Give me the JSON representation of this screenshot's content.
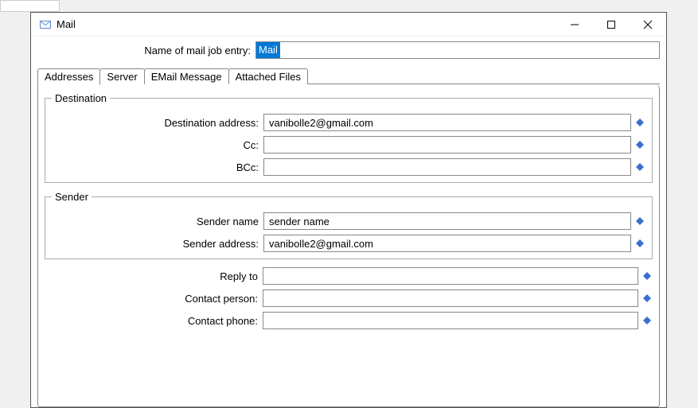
{
  "window": {
    "title": "Mail"
  },
  "topfield": {
    "label": "Name of mail job entry:",
    "value": "Mail"
  },
  "tabs": {
    "addresses": "Addresses",
    "server": "Server",
    "email_message": "EMail Message",
    "attached_files": "Attached Files"
  },
  "destination": {
    "legend": "Destination",
    "address_label": "Destination address:",
    "address_value": "vanibolle2@gmail.com",
    "cc_label": "Cc:",
    "cc_value": "",
    "bcc_label": "BCc:",
    "bcc_value": ""
  },
  "sender": {
    "legend": "Sender",
    "name_label": "Sender name",
    "name_value": "sender name",
    "address_label": "Sender address:",
    "address_value": "vanibolle2@gmail.com"
  },
  "plain": {
    "reply_to_label": "Reply to",
    "reply_to_value": "",
    "contact_person_label": "Contact person:",
    "contact_person_value": "",
    "contact_phone_label": "Contact phone:",
    "contact_phone_value": ""
  }
}
